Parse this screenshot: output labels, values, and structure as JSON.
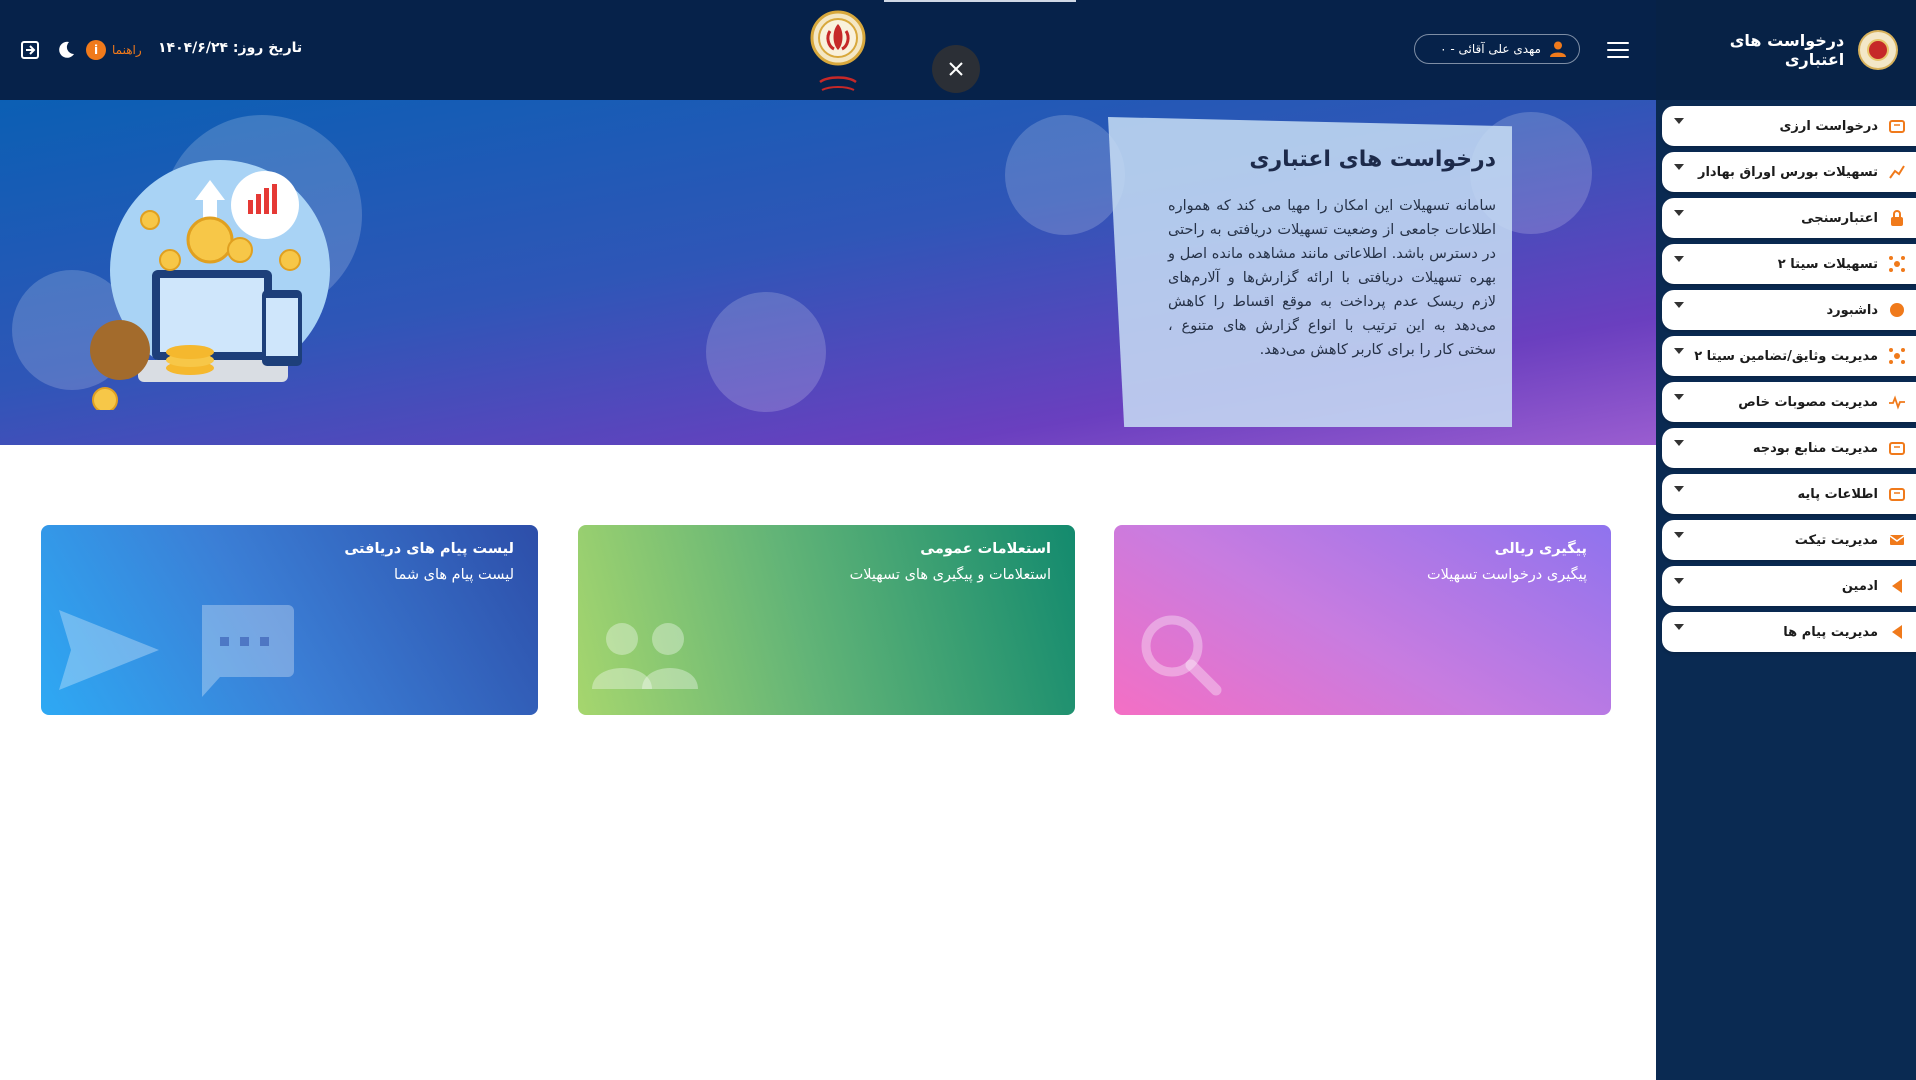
{
  "sidebar": {
    "title": "درخواست های اعتباری",
    "items": [
      {
        "label": "درخواست ارزی",
        "icon": "coins-icon"
      },
      {
        "label": "تسهیلات بورس اوراق بهادار",
        "icon": "chart-icon"
      },
      {
        "label": "اعتبارسنجی",
        "icon": "lock-icon"
      },
      {
        "label": "تسهیلات سیتا ۲",
        "icon": "network-icon"
      },
      {
        "label": "داشبورد",
        "icon": "dot-icon"
      },
      {
        "label": "مدیریت وثایق/تضامین سیتا ۲",
        "icon": "network-icon"
      },
      {
        "label": "مدیریت مصوبات خاص",
        "icon": "pulse-icon"
      },
      {
        "label": "مدیریت منابع بودجه",
        "icon": "coins-icon"
      },
      {
        "label": "اطلاعات پایه",
        "icon": "coins-icon"
      },
      {
        "label": "مدیریت تیکت",
        "icon": "ticket-icon"
      },
      {
        "label": "ادمین",
        "icon": "triangle-icon"
      },
      {
        "label": "مدیریت پیام ها",
        "icon": "triangle-icon"
      }
    ]
  },
  "header": {
    "date_label": "تاریخ روز:",
    "date_value": "۱۴۰۴/۶/۲۴",
    "help_label": "راهنما",
    "help_icon_glyph": "i",
    "user_name": "مهدی علی آقائی - ۰",
    "accent_color": "#f07a1b",
    "bg_color": "#06224a"
  },
  "hero": {
    "title": "درخواست های اعتباری",
    "text": "سامانه تسهیلات این امکان را مهیا می کند که همواره اطلاعات جامعی از وضعیت تسهیلات دریافتی به راحتی در دسترس باشد. اطلاعاتی مانند مشاهده مانده اصل و بهره تسهیلات دریافتی با ارائه گزارش‌ها و آلارم‌های لازم ریسک عدم پرداخت به موقع اقساط را کاهش می‌دهد به این ترتیب با انواع گزارش های متنوع ، سختی کار را برای کاربر کاهش می‌دهد."
  },
  "cards": [
    {
      "title": "پیگیری ریالی",
      "subtitle": "پیگیری درخواست تسهیلات",
      "icon": "search-icon"
    },
    {
      "title": "استعلامات عمومی",
      "subtitle": "استعلامات و پیگیری های تسهیلات",
      "icon": "users-icon"
    },
    {
      "title": "لیست پیام های دریافتی",
      "subtitle": "لیست پیام های شما",
      "icon": "chat-icon"
    }
  ]
}
